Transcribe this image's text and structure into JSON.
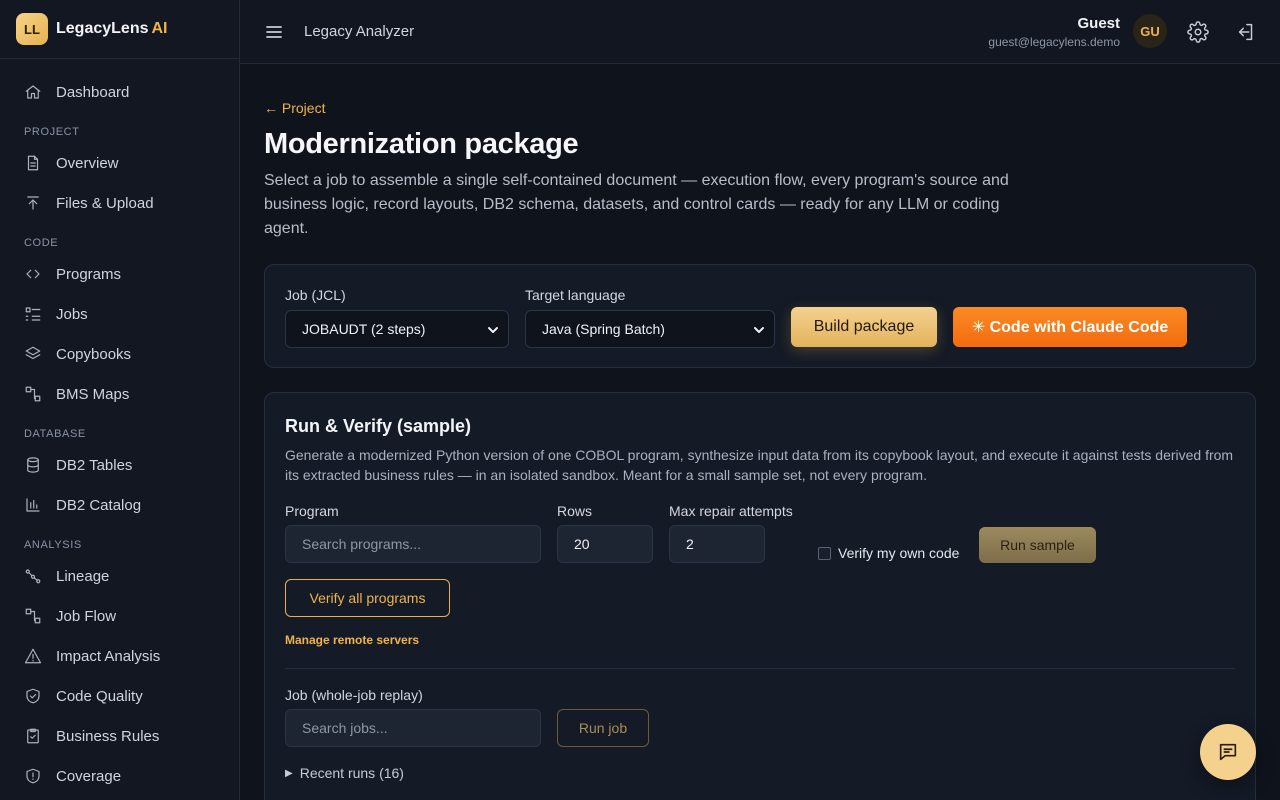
{
  "brand": {
    "logo_initials": "LL",
    "name": "LegacyLens",
    "ai_suffix": "AI"
  },
  "sidebar": {
    "items": [
      {
        "label": "Dashboard",
        "icon": "home-icon"
      },
      {
        "section": "PROJECT"
      },
      {
        "label": "Overview",
        "icon": "file-icon"
      },
      {
        "label": "Files & Upload",
        "icon": "upload-icon"
      },
      {
        "section": "CODE"
      },
      {
        "label": "Programs",
        "icon": "code-icon"
      },
      {
        "label": "Jobs",
        "icon": "list-icon"
      },
      {
        "label": "Copybooks",
        "icon": "layers-icon"
      },
      {
        "label": "BMS Maps",
        "icon": "map-icon"
      },
      {
        "section": "DATABASE"
      },
      {
        "label": "DB2 Tables",
        "icon": "database-icon"
      },
      {
        "label": "DB2 Catalog",
        "icon": "bar-chart-icon"
      },
      {
        "section": "ANALYSIS"
      },
      {
        "label": "Lineage",
        "icon": "share-icon"
      },
      {
        "label": "Job Flow",
        "icon": "flow-icon"
      },
      {
        "label": "Impact Analysis",
        "icon": "warning-icon"
      },
      {
        "label": "Code Quality",
        "icon": "shield-check-icon"
      },
      {
        "label": "Business Rules",
        "icon": "clipboard-icon"
      },
      {
        "label": "Coverage",
        "icon": "shield-alert-icon"
      }
    ]
  },
  "header": {
    "title": "Legacy Analyzer",
    "user_name": "Guest",
    "user_email": "guest@legacylens.demo",
    "avatar_initials": "GU"
  },
  "main": {
    "back_link": "← Project",
    "title": "Modernization package",
    "description": "Select a job to assemble a single self-contained document — execution flow, every program's source and business logic, record layouts, DB2 schema, datasets, and control cards — ready for any LLM or coding agent.",
    "package": {
      "job_label": "Job (JCL)",
      "job_value": "JOBAUDT (2 steps)",
      "lang_label": "Target language",
      "lang_value": "Java (Spring Batch)",
      "build_label": "Build package",
      "claude_label": "✳ Code with Claude Code"
    },
    "verify": {
      "title": "Run & Verify (sample)",
      "description": "Generate a modernized Python version of one COBOL program, synthesize input data from its copybook layout, and execute it against tests derived from its extracted business rules — in an isolated sandbox. Meant for a small sample set, not every program.",
      "program_label": "Program",
      "program_placeholder": "Search programs...",
      "rows_label": "Rows",
      "rows_value": "20",
      "repair_label": "Max repair attempts",
      "repair_value": "2",
      "verify_own_label": "Verify my own code",
      "run_sample_label": "Run sample",
      "verify_all_label": "Verify all programs",
      "manage_servers_label": "Manage remote servers",
      "job_replay_label": "Job (whole-job replay)",
      "job_placeholder": "Search jobs...",
      "run_job_label": "Run job",
      "recent_runs_label": "Recent runs (16)"
    }
  },
  "colors": {
    "accent": "#f0b34a",
    "claude": "#f26c10",
    "background": "#0f131c"
  }
}
